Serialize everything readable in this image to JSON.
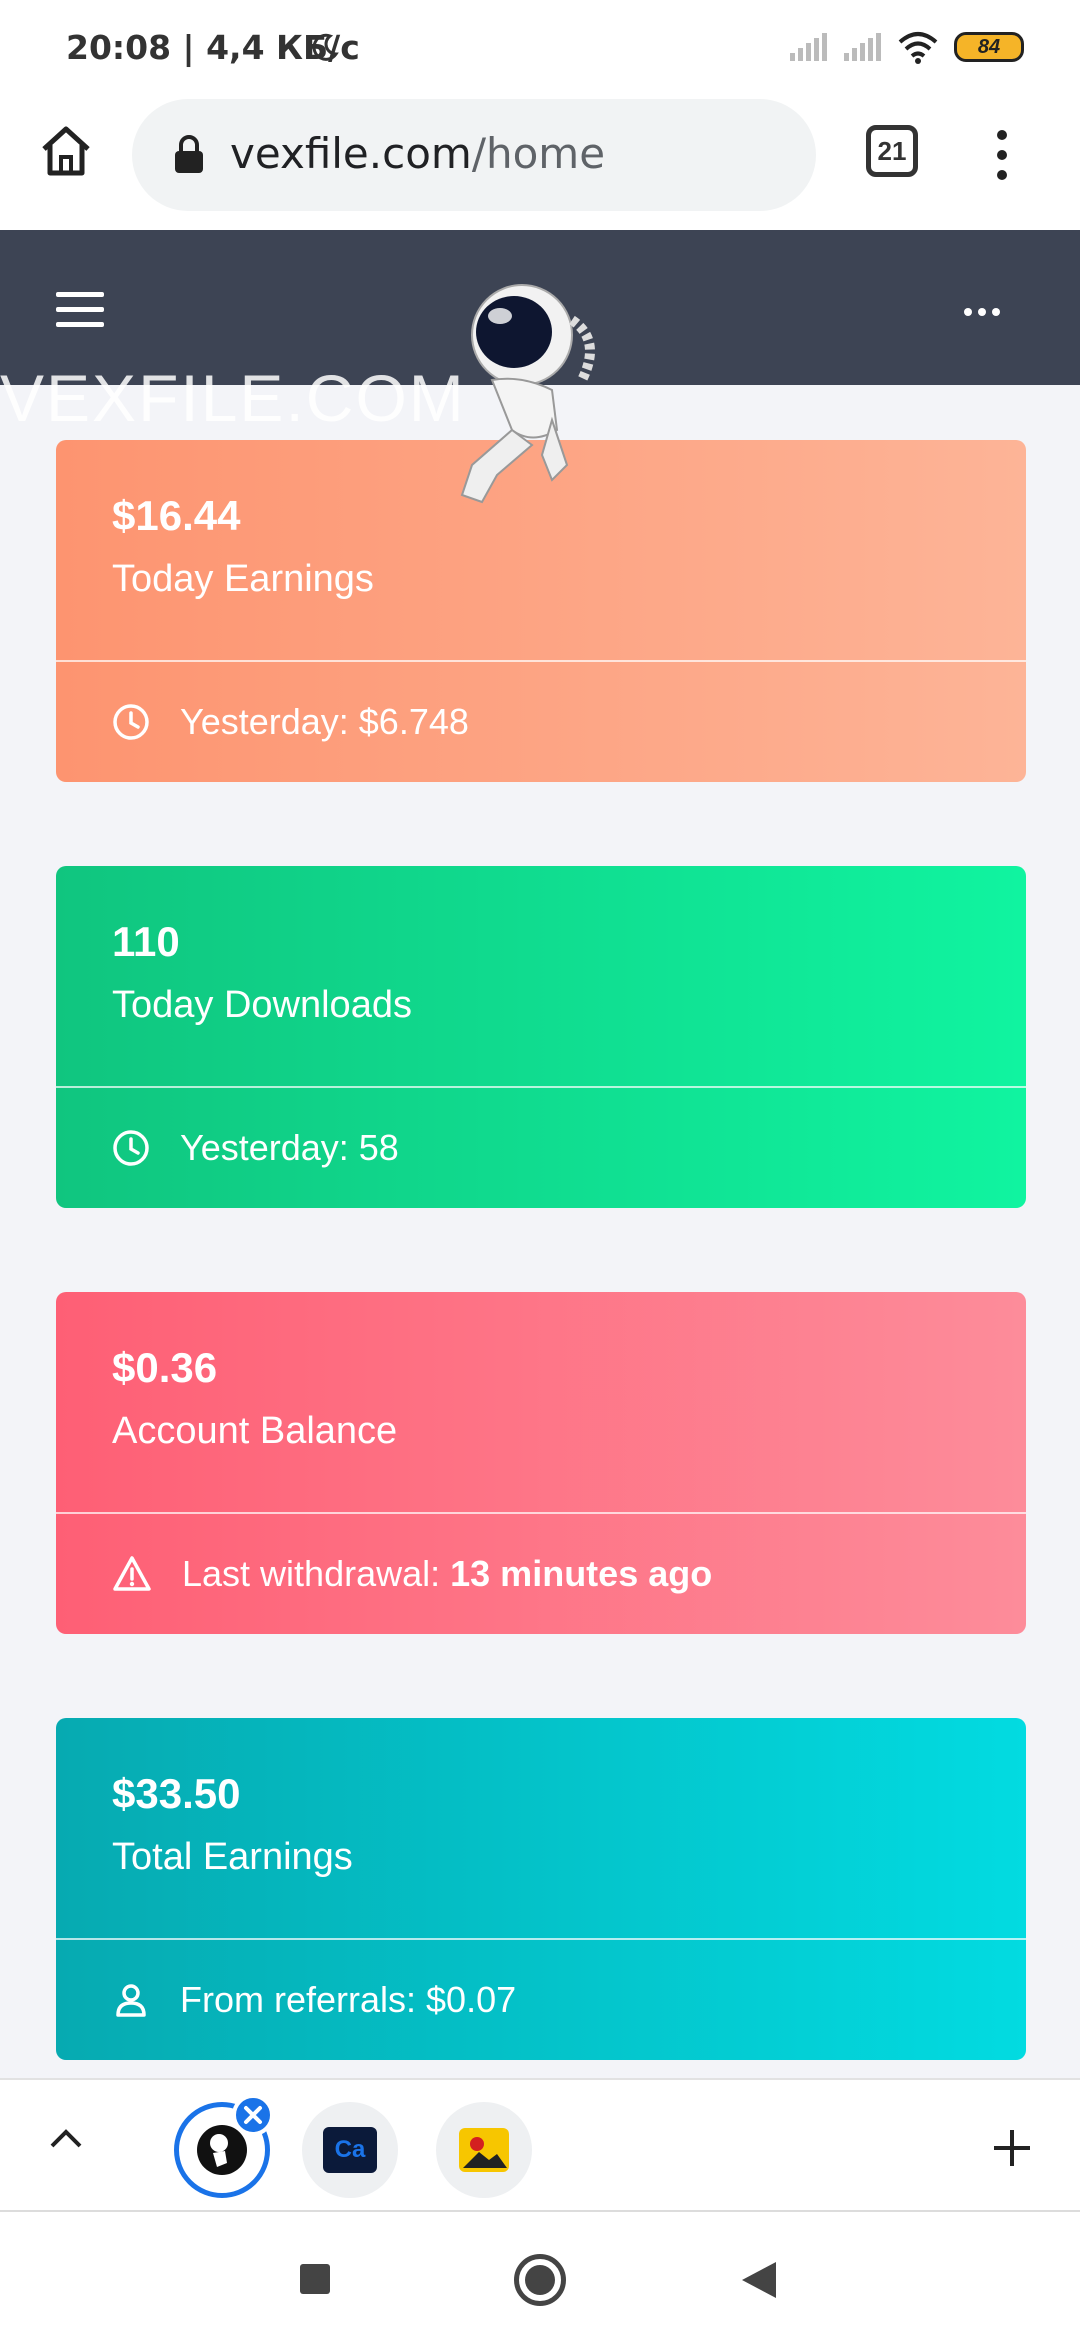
{
  "status": {
    "time": "20:08 | 4,4 КБ/с",
    "battery": "84"
  },
  "browser": {
    "url_domain": "vexfile.com",
    "url_path": "/home",
    "tab_count": "21"
  },
  "header": {
    "logo_text": "VEXFILE.COM"
  },
  "cards": [
    {
      "value": "$16.44",
      "label": "Today Earnings",
      "footer": "Yesterday: $6.748",
      "icon": "clock-icon"
    },
    {
      "value": "110",
      "label": "Today Downloads",
      "footer": "Yesterday: 58",
      "icon": "clock-icon"
    },
    {
      "value": "$0.36",
      "label": "Account Balance",
      "footer_prefix": "Last withdrawal:",
      "footer_bold": "13 minutes ago",
      "icon": "warning-icon"
    },
    {
      "value": "$33.50",
      "label": "Total Earnings",
      "footer": "From referrals: $0.07",
      "icon": "user-icon"
    }
  ],
  "tabstrip": {
    "tab2_label": "Ca"
  },
  "colors": {
    "header_bg": "#3d4454",
    "card_earnings": "#fd9470",
    "card_downloads": "#10c57f",
    "card_balance": "#fe5f75",
    "card_total": "#06aab1",
    "accent": "#1a73e8"
  }
}
